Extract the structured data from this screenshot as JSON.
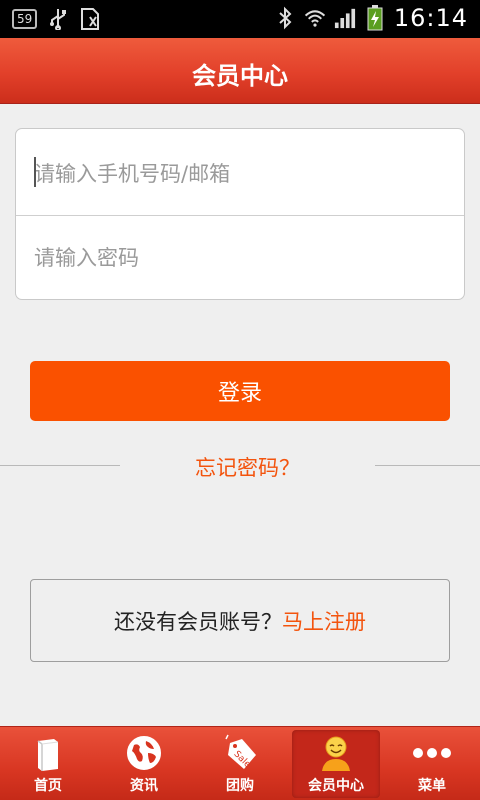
{
  "status_bar": {
    "notification_badge": "59",
    "time": "16:14"
  },
  "header": {
    "title": "会员中心"
  },
  "login_form": {
    "phone_placeholder": "请输入手机号码/邮箱",
    "password_placeholder": "请输入密码"
  },
  "login_button_label": "登录",
  "forgot_password_label": "忘记密码？",
  "register": {
    "prompt": "还没有会员账号？",
    "link_label": "马上注册"
  },
  "tabs": [
    {
      "label": "首页",
      "icon": "book-icon"
    },
    {
      "label": "资讯",
      "icon": "globe-icon"
    },
    {
      "label": "团购",
      "icon": "sale-tag-icon"
    },
    {
      "label": "会员中心",
      "icon": "member-icon",
      "active": true
    },
    {
      "label": "菜单",
      "icon": "more-dots-icon"
    }
  ],
  "colors": {
    "accent": "#fa5100",
    "link": "#f3540e",
    "header": "#e2402a"
  }
}
